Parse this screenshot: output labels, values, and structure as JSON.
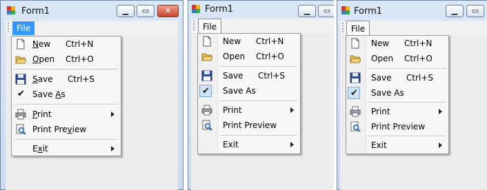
{
  "window": {
    "title": "Form1"
  },
  "menubar": {
    "file_label": "File"
  },
  "menu": {
    "new": {
      "label": "New",
      "shortcut": "Ctrl+N"
    },
    "open": {
      "label": "Open",
      "shortcut": "Ctrl+O"
    },
    "save": {
      "label": "Save",
      "shortcut": "Ctrl+S"
    },
    "save_as": {
      "label": "Save As",
      "checked": true
    },
    "print": {
      "label": "Print",
      "has_submenu": true
    },
    "print_preview": {
      "label": "Print Preview"
    },
    "exit": {
      "label": "Exit",
      "has_submenu": true
    }
  },
  "xp_mnemonics": {
    "new": [
      "",
      "N",
      "ew"
    ],
    "open": [
      "",
      "O",
      "pen"
    ],
    "save": [
      "",
      "S",
      "ave"
    ],
    "save_as": [
      "Save ",
      "A",
      "s"
    ],
    "print": [
      "",
      "P",
      "rint"
    ],
    "print_preview": [
      "Print Pre",
      "v",
      "iew"
    ],
    "exit": [
      "E",
      "x",
      "it"
    ]
  },
  "icons": {
    "new": "new-document-icon",
    "open": "open-folder-icon",
    "save": "floppy-save-icon",
    "print": "printer-icon",
    "print_preview": "print-preview-icon",
    "window_controls": [
      "minimize-icon",
      "maximize-icon",
      "close-icon"
    ]
  },
  "colors": {
    "menu_highlight": "#3399ff",
    "check_box": "#cfe3f6",
    "close_button": "#c8452c"
  }
}
